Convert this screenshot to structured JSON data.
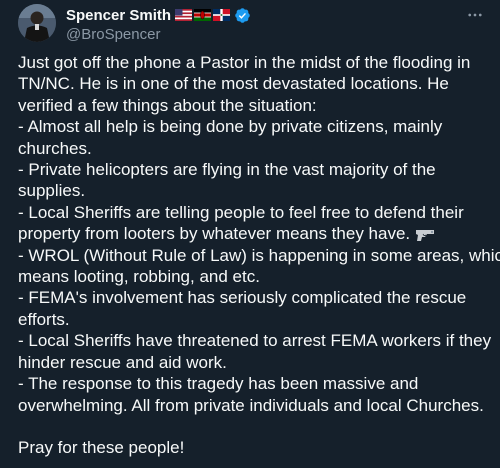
{
  "author": {
    "display_name": "Spencer Smith",
    "handle": "@BroSpencer",
    "flags": [
      "us-flag",
      "kenya-flag",
      "dominican-republic-flag"
    ],
    "verified": true,
    "verified_color": "#1d9bf0"
  },
  "post": {
    "lines": [
      "Just got off the phone a Pastor in the midst of the flooding in",
      "TN/NC. He is in one of the most devastated locations. He",
      "verified a few things about the situation:",
      "- Almost all help is being done by private citizens, mainly",
      "churches.",
      "- Private helicopters are flying in the vast majority of the",
      "supplies.",
      "- Local Sheriffs are telling people to feel free to defend their",
      "property from looters by whatever means they have.",
      "- WROL (Without Rule of Law) is happening in some areas, which",
      "means looting, robbing, and etc.",
      "- FEMA's involvement has seriously complicated the rescue",
      "efforts.",
      "- Local Sheriffs have threatened to arrest FEMA workers if they",
      "hinder rescue and aid work.",
      "- The response to this tragedy has been massive and",
      "overwhelming. All from private individuals and local Churches.",
      "",
      "Pray for these people!"
    ],
    "inline_emoji": "pistol-icon"
  },
  "colors": {
    "background": "#15202b",
    "text": "#f7f9f9",
    "secondary_text": "#8b98a5"
  },
  "icons": {
    "more": "more-horizontal-icon",
    "verified": "verified-badge-icon"
  }
}
